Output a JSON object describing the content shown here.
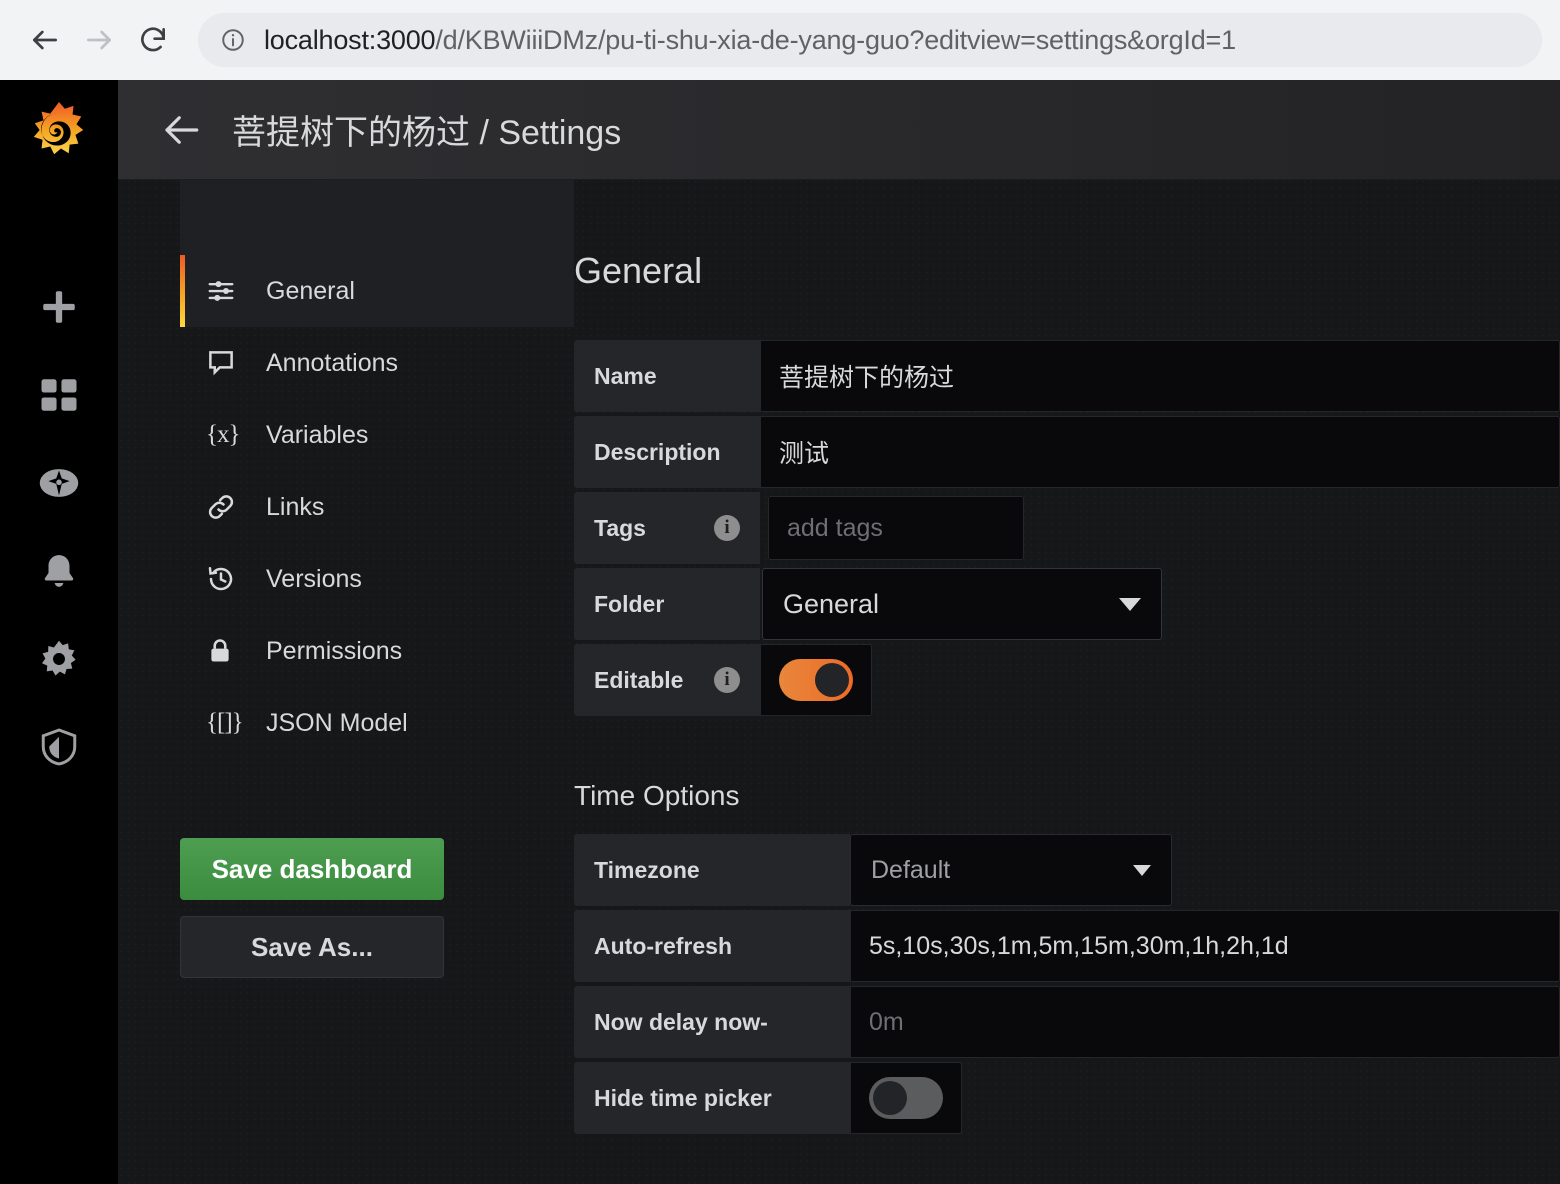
{
  "browser": {
    "url_host": "localhost:3000",
    "url_path": "/d/KBWiiiDMz/pu-ti-shu-xia-de-yang-guo?editview=settings&orgId=1",
    "back_icon": "back-arrow-icon",
    "forward_icon": "forward-arrow-icon",
    "reload_icon": "reload-icon",
    "site_info_icon": "info-circle-icon"
  },
  "rail": {
    "logo": "grafana-logo",
    "items": [
      {
        "icon": "plus-icon",
        "name": "create"
      },
      {
        "icon": "dashboards-grid-icon",
        "name": "dashboards"
      },
      {
        "icon": "compass-icon",
        "name": "explore"
      },
      {
        "icon": "bell-icon",
        "name": "alerting"
      },
      {
        "icon": "gear-icon",
        "name": "configuration"
      },
      {
        "icon": "shield-icon",
        "name": "server-admin"
      }
    ]
  },
  "header": {
    "back_icon": "arrow-left-icon",
    "title": "菩提树下的杨过 / Settings"
  },
  "settings_nav": {
    "items": [
      {
        "label": "General",
        "icon": "sliders-icon",
        "active": true
      },
      {
        "label": "Annotations",
        "icon": "comment-icon",
        "active": false
      },
      {
        "label": "Variables",
        "icon": "{x}",
        "active": false
      },
      {
        "label": "Links",
        "icon": "link-icon",
        "active": false
      },
      {
        "label": "Versions",
        "icon": "history-icon",
        "active": false
      },
      {
        "label": "Permissions",
        "icon": "lock-icon",
        "active": false
      },
      {
        "label": "JSON Model",
        "icon": "{[]}",
        "active": false
      }
    ]
  },
  "actions": {
    "save_dashboard": "Save dashboard",
    "save_as": "Save As..."
  },
  "general": {
    "heading": "General",
    "name_label": "Name",
    "name_value": "菩提树下的杨过",
    "description_label": "Description",
    "description_value": "测试",
    "tags_label": "Tags",
    "tags_placeholder": "add tags",
    "folder_label": "Folder",
    "folder_value": "General",
    "editable_label": "Editable",
    "editable_on": true
  },
  "time_options": {
    "heading": "Time Options",
    "timezone_label": "Timezone",
    "timezone_value": "Default",
    "autorefresh_label": "Auto-refresh",
    "autorefresh_value": "5s,10s,30s,1m,5m,15m,30m,1h,2h,1d",
    "nowdelay_label": "Now delay now-",
    "nowdelay_placeholder": "0m",
    "hidetimepicker_label": "Hide time picker",
    "hidetimepicker_on": false
  },
  "colors": {
    "accent_orange": "#ec6b27",
    "save_green": "#3c8c40",
    "panel_bg": "#1f2023",
    "field_bg": "#09090b",
    "text": "#d8d9da"
  }
}
